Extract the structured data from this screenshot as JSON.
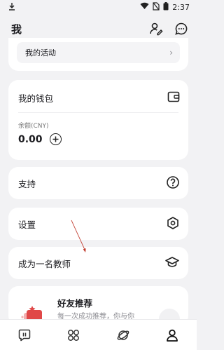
{
  "status_bar": {
    "time": "2:37"
  },
  "header": {
    "title": "我"
  },
  "activity": {
    "label": "我的活动"
  },
  "wallet": {
    "title": "我的钱包",
    "balance_label": "余额(CNY)",
    "balance": "0.00"
  },
  "menu": {
    "support": "支持",
    "settings": "设置",
    "become_teacher": "成为一名教师"
  },
  "invite": {
    "title": "好友推荐",
    "description": "每一次成功推荐，你与你"
  },
  "bottom_nav": {
    "items": [
      "chat",
      "apps",
      "explore",
      "profile"
    ],
    "active": "profile"
  },
  "colors": {
    "annotation_arrow": "#c0392b",
    "invite_accent": "#e04848"
  }
}
